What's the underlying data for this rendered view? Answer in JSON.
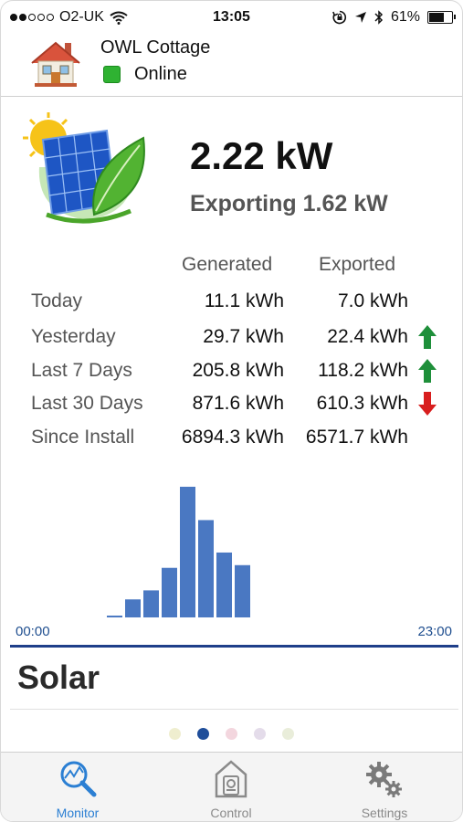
{
  "status_bar": {
    "carrier": "O2-UK",
    "time": "13:05",
    "battery": "61%",
    "signal_bars_filled": 2,
    "battery_level": 0.61
  },
  "header": {
    "site_name": "OWL Cottage",
    "status": "Online",
    "status_color": "#2fb232"
  },
  "summary": {
    "power": "2.22 kW",
    "export": "Exporting 1.62 kW"
  },
  "stats": {
    "col_generated": "Generated",
    "col_exported": "Exported",
    "rows": [
      {
        "label": "Today",
        "generated": "11.1 kWh",
        "exported": "7.0 kWh",
        "trend": "none"
      },
      {
        "label": "Yesterday",
        "generated": "29.7 kWh",
        "exported": "22.4 kWh",
        "trend": "up"
      },
      {
        "label": "Last 7 Days",
        "generated": "205.8 kWh",
        "exported": "118.2 kWh",
        "trend": "up"
      },
      {
        "label": "Last 30 Days",
        "generated": "871.6 kWh",
        "exported": "610.3 kWh",
        "trend": "down"
      },
      {
        "label": "Since Install",
        "generated": "6894.3 kWh",
        "exported": "6571.7 kWh",
        "trend": "none"
      }
    ],
    "trend_colors": {
      "up": "#1e8f3a",
      "down": "#d81e1e"
    }
  },
  "chart_data": {
    "type": "bar",
    "x_start": "00:00",
    "x_end": "23:00",
    "bar_color": "#4a78c2",
    "values": [
      0.02,
      0.2,
      0.3,
      0.55,
      1.45,
      1.08,
      0.72,
      0.58
    ],
    "ylim": [
      0,
      1.5
    ]
  },
  "section": {
    "title": "Solar"
  },
  "pager": {
    "active_index": 1,
    "dots": [
      "#efeecf",
      "#1f4e9a",
      "#f3d6de",
      "#e4dcea",
      "#e9edda"
    ]
  },
  "tabs": [
    {
      "label": "Monitor",
      "icon": "monitor-icon",
      "active": true
    },
    {
      "label": "Control",
      "icon": "control-icon",
      "active": false
    },
    {
      "label": "Settings",
      "icon": "settings-icon",
      "active": false
    }
  ]
}
